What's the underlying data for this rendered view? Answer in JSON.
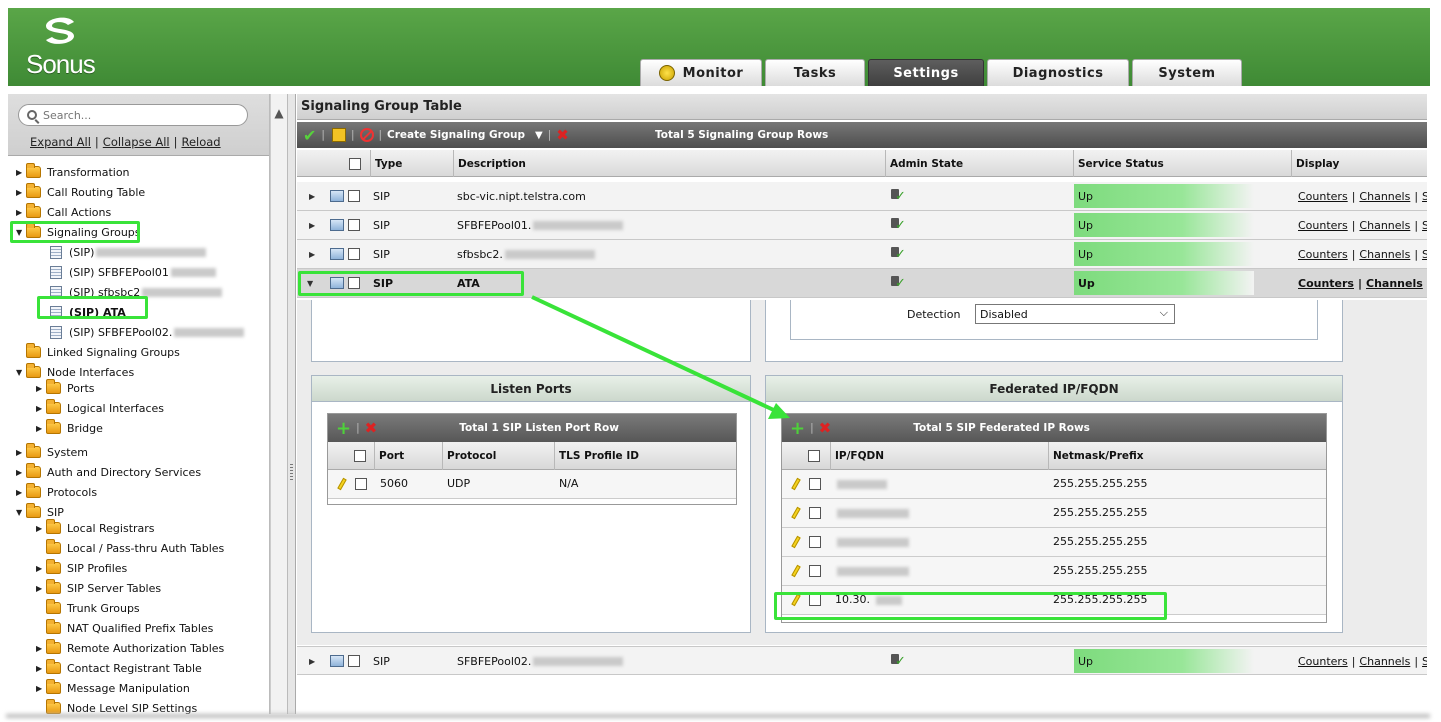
{
  "brand": {
    "name": "Sonus"
  },
  "tabs": [
    {
      "label": "Monitor"
    },
    {
      "label": "Tasks"
    },
    {
      "label": "Settings"
    },
    {
      "label": "Diagnostics"
    },
    {
      "label": "System"
    }
  ],
  "sidebar": {
    "search_placeholder": "Search...",
    "links": {
      "expand": "Expand All",
      "collapse": "Collapse All",
      "reload": "Reload"
    },
    "items": [
      {
        "label": "Transformation"
      },
      {
        "label": "Call Routing Table"
      },
      {
        "label": "Call Actions"
      },
      {
        "label": "Signaling Groups"
      },
      {
        "label": "(SIP)"
      },
      {
        "label": "(SIP) SFBFEPool01"
      },
      {
        "label": "(SIP) sfbsbc2"
      },
      {
        "label": "(SIP) ATA"
      },
      {
        "label": "(SIP) SFBFEPool02."
      },
      {
        "label": "Linked Signaling Groups"
      },
      {
        "label": "Node Interfaces"
      },
      {
        "label": "Ports"
      },
      {
        "label": "Logical Interfaces"
      },
      {
        "label": "Bridge"
      },
      {
        "label": "System"
      },
      {
        "label": "Auth and Directory Services"
      },
      {
        "label": "Protocols"
      },
      {
        "label": "SIP"
      },
      {
        "label": "Local Registrars"
      },
      {
        "label": "Local / Pass-thru Auth Tables"
      },
      {
        "label": "SIP Profiles"
      },
      {
        "label": "SIP Server Tables"
      },
      {
        "label": "Trunk Groups"
      },
      {
        "label": "NAT Qualified Prefix Tables"
      },
      {
        "label": "Remote Authorization Tables"
      },
      {
        "label": "Contact Registrant Table"
      },
      {
        "label": "Message Manipulation"
      },
      {
        "label": "Node Level SIP Settings"
      }
    ]
  },
  "main": {
    "title": "Signaling Group Table",
    "toolbar": {
      "create_label": "Create Signaling Group",
      "total": "Total 5 Signaling Group Rows"
    },
    "columns": [
      "Type",
      "Description",
      "Admin State",
      "Service Status",
      "Display"
    ],
    "rows": [
      {
        "type": "SIP",
        "description": "sbc-vic.nipt.telstra.com",
        "status": "Up"
      },
      {
        "type": "SIP",
        "description": "SFBFEPool01.",
        "status": "Up"
      },
      {
        "type": "SIP",
        "description": "sfbsbc2.",
        "status": "Up"
      },
      {
        "type": "SIP",
        "description": "ATA",
        "status": "Up"
      }
    ],
    "display_links": {
      "counters": "Counters",
      "channels": "Channels",
      "more": "Se"
    },
    "bottom_row": {
      "type": "SIP",
      "description": "SFBFEPool02.",
      "status": "Up"
    },
    "detection": {
      "label": "Detection",
      "value": "Disabled"
    },
    "listen_ports": {
      "title": "Listen Ports",
      "total": "Total 1 SIP Listen Port Row",
      "columns": [
        "Port",
        "Protocol",
        "TLS Profile ID"
      ],
      "rows": [
        {
          "port": "5060",
          "protocol": "UDP",
          "tls": "N/A"
        }
      ]
    },
    "federated": {
      "title": "Federated IP/FQDN",
      "total": "Total 5 SIP Federated IP Rows",
      "columns": [
        "IP/FQDN",
        "Netmask/Prefix"
      ],
      "rows": [
        {
          "ip": "",
          "mask": "255.255.255.255"
        },
        {
          "ip": "",
          "mask": "255.255.255.255"
        },
        {
          "ip": "",
          "mask": "255.255.255.255"
        },
        {
          "ip": "",
          "mask": "255.255.255.255"
        },
        {
          "ip": "10.30.",
          "mask": "255.255.255.255"
        }
      ]
    }
  },
  "colors": {
    "header_green": "#4a9a3c",
    "highlight": "#39e339",
    "status_up": "#7ddb7d"
  }
}
